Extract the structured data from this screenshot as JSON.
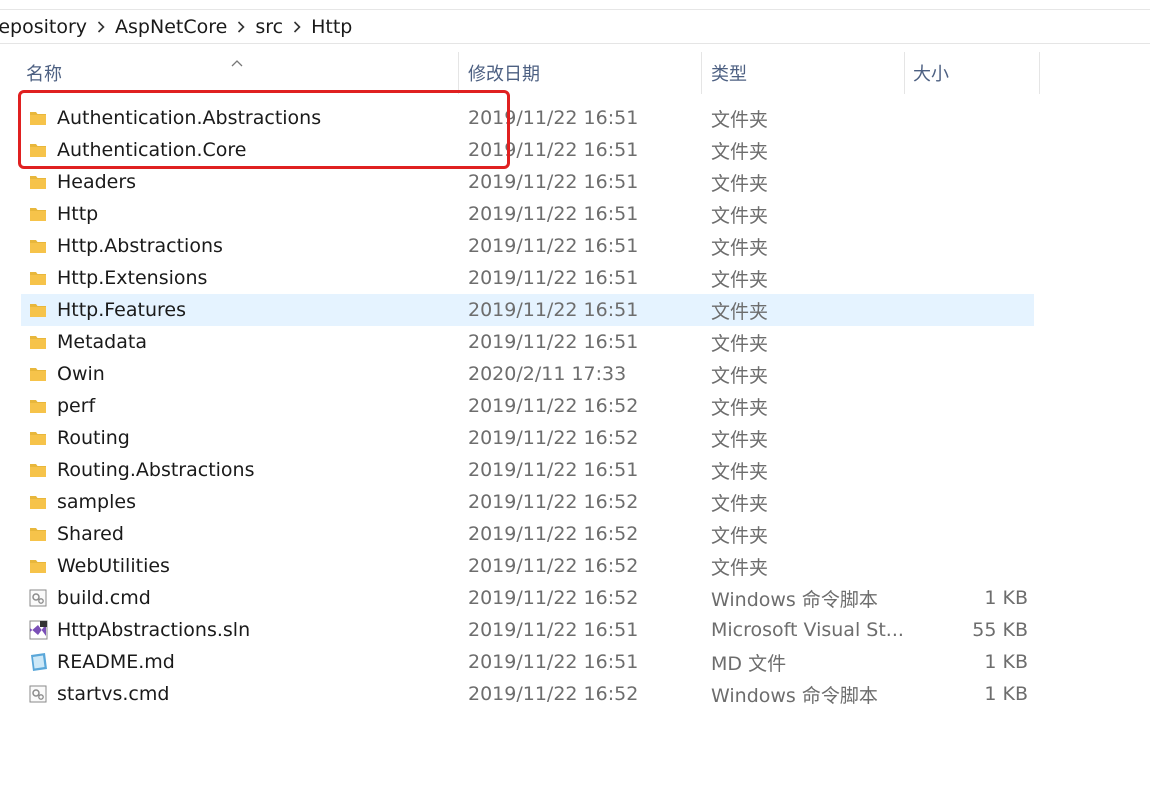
{
  "breadcrumb": [
    "Repository",
    "AspNetCore",
    "src",
    "Http"
  ],
  "columns": {
    "name": "名称",
    "date": "修改日期",
    "type": "类型",
    "size": "大小"
  },
  "files": [
    {
      "name": "Authentication.Abstractions",
      "date": "2019/11/22 16:51",
      "type": "文件夹",
      "size": "",
      "icon": "folder-icon"
    },
    {
      "name": "Authentication.Core",
      "date": "2019/11/22 16:51",
      "type": "文件夹",
      "size": "",
      "icon": "folder-icon"
    },
    {
      "name": "Headers",
      "date": "2019/11/22 16:51",
      "type": "文件夹",
      "size": "",
      "icon": "folder-icon"
    },
    {
      "name": "Http",
      "date": "2019/11/22 16:51",
      "type": "文件夹",
      "size": "",
      "icon": "folder-icon"
    },
    {
      "name": "Http.Abstractions",
      "date": "2019/11/22 16:51",
      "type": "文件夹",
      "size": "",
      "icon": "folder-icon"
    },
    {
      "name": "Http.Extensions",
      "date": "2019/11/22 16:51",
      "type": "文件夹",
      "size": "",
      "icon": "folder-icon"
    },
    {
      "name": "Http.Features",
      "date": "2019/11/22 16:51",
      "type": "文件夹",
      "size": "",
      "icon": "folder-icon",
      "selected": true
    },
    {
      "name": "Metadata",
      "date": "2019/11/22 16:51",
      "type": "文件夹",
      "size": "",
      "icon": "folder-icon"
    },
    {
      "name": "Owin",
      "date": "2020/2/11 17:33",
      "type": "文件夹",
      "size": "",
      "icon": "folder-icon"
    },
    {
      "name": "perf",
      "date": "2019/11/22 16:52",
      "type": "文件夹",
      "size": "",
      "icon": "folder-icon"
    },
    {
      "name": "Routing",
      "date": "2019/11/22 16:52",
      "type": "文件夹",
      "size": "",
      "icon": "folder-icon"
    },
    {
      "name": "Routing.Abstractions",
      "date": "2019/11/22 16:51",
      "type": "文件夹",
      "size": "",
      "icon": "folder-icon"
    },
    {
      "name": "samples",
      "date": "2019/11/22 16:52",
      "type": "文件夹",
      "size": "",
      "icon": "folder-icon"
    },
    {
      "name": "Shared",
      "date": "2019/11/22 16:52",
      "type": "文件夹",
      "size": "",
      "icon": "folder-icon"
    },
    {
      "name": "WebUtilities",
      "date": "2019/11/22 16:52",
      "type": "文件夹",
      "size": "",
      "icon": "folder-icon"
    },
    {
      "name": "build.cmd",
      "date": "2019/11/22 16:52",
      "type": "Windows 命令脚本",
      "size": "1 KB",
      "icon": "cmd-file-icon"
    },
    {
      "name": "HttpAbstractions.sln",
      "date": "2019/11/22 16:51",
      "type": "Microsoft Visual St...",
      "size": "55 KB",
      "icon": "visual-studio-solution-icon"
    },
    {
      "name": "README.md",
      "date": "2019/11/22 16:51",
      "type": "MD 文件",
      "size": "1 KB",
      "icon": "markdown-file-icon"
    },
    {
      "name": "startvs.cmd",
      "date": "2019/11/22 16:52",
      "type": "Windows 命令脚本",
      "size": "1 KB",
      "icon": "cmd-file-icon"
    }
  ],
  "colors": {
    "selection": "#e5f3ff",
    "highlight_box": "#e02020",
    "header_text": "#4d6082",
    "folder": "#f6c34a"
  }
}
